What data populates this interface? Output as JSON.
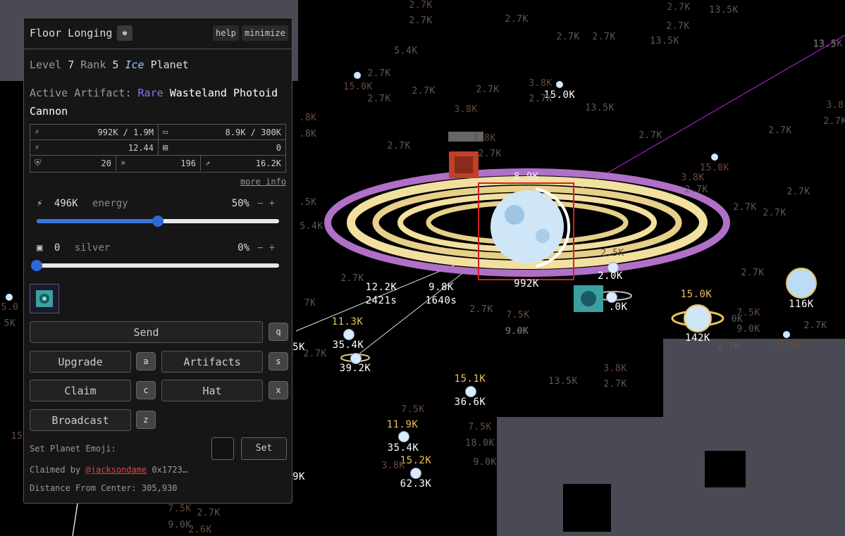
{
  "panel": {
    "title": "Floor Longing",
    "help_label": "help",
    "minimize_label": "minimize",
    "level_label": "Level",
    "level_value": "7",
    "rank_label": "Rank",
    "rank_value": "5",
    "planet_type_tag": "Ice",
    "planet_word": "Planet",
    "artifact_label": "Active Artifact:",
    "artifact_rarity": "Rare",
    "artifact_name_line1": "Wasteland Photoid",
    "artifact_name_line2": "Cannon",
    "stats": {
      "energy": "992K / 1.9M",
      "silver": "8.9K / 300K",
      "energy_growth": "12.44",
      "silver_growth": "0",
      "defense": "20",
      "speed": "196",
      "range": "16.2K"
    },
    "more_info": "more info",
    "energy_slider": {
      "amount": "496K",
      "label": "energy",
      "percent": "50%",
      "fraction": 0.5,
      "minus": "−",
      "plus": "+"
    },
    "silver_slider": {
      "amount": "0",
      "label": "silver",
      "percent": "0%",
      "fraction": 0.0,
      "minus": "−",
      "plus": "+"
    },
    "buttons": {
      "send": "Send",
      "send_key": "q",
      "upgrade": "Upgrade",
      "upgrade_key": "a",
      "artifacts": "Artifacts",
      "artifacts_key": "s",
      "claim": "Claim",
      "claim_key": "c",
      "hat": "Hat",
      "hat_key": "x",
      "broadcast": "Broadcast",
      "broadcast_key": "z"
    },
    "emoji_label": "Set Planet Emoji:",
    "set_label": "Set",
    "claimed_by_label": "Claimed by",
    "claimed_by_user": "@jacksondame",
    "claimed_by_address": "0x1723…",
    "distance_label": "Distance From Center:",
    "distance_value": "305,930"
  },
  "map": {
    "selected_planet": {
      "energy_label": "8.9K",
      "bottom_label": "992K"
    },
    "fleet_a": {
      "amount": "12.2K",
      "eta": "2421s"
    },
    "fleet_b": {
      "amount": "9.8K",
      "eta": "1640s"
    },
    "labels": [
      {
        "text": "2.7K",
        "c": "brown"
      },
      {
        "text": "2.7K",
        "c": "grey"
      },
      {
        "text": "2.7K",
        "c": "grey"
      },
      {
        "text": "2.7K",
        "c": "grey"
      },
      {
        "text": "2.7K",
        "c": "grey"
      },
      {
        "text": "2.7K",
        "c": "brown"
      },
      {
        "text": "13.5K",
        "c": "grey"
      },
      {
        "text": "2.7K",
        "c": "grey"
      },
      {
        "text": "13.5K",
        "c": "grey"
      },
      {
        "text": "13.5K",
        "c": "grey"
      },
      {
        "text": "5.4K",
        "c": "grey"
      },
      {
        "text": "2.7K",
        "c": "grey"
      },
      {
        "text": "15.0K",
        "c": "brown"
      },
      {
        "text": "2.7K",
        "c": "grey"
      },
      {
        "text": "2.7K",
        "c": "grey"
      },
      {
        "text": "2.7K",
        "c": "grey"
      },
      {
        "text": "3.8K",
        "c": "brown"
      },
      {
        "text": "15.0K",
        "c": "white"
      },
      {
        "text": "2.7K",
        "c": "grey"
      },
      {
        "text": "13.5K",
        "c": "grey"
      },
      {
        "text": "3.8K",
        "c": "brown"
      },
      {
        "text": "3.8K",
        "c": "brown"
      },
      {
        "text": "2.7K",
        "c": "grey"
      },
      {
        "text": "2.7K",
        "c": "grey"
      },
      {
        "text": "2.7K",
        "c": "grey"
      },
      {
        "text": "2.7K",
        "c": "grey"
      },
      {
        "text": "15.0K",
        "c": "brown"
      },
      {
        "text": "3.8K",
        "c": "brown"
      },
      {
        "text": "2.7K",
        "c": "grey"
      },
      {
        "text": "2.7K",
        "c": "grey"
      },
      {
        "text": "2.7K",
        "c": "grey"
      },
      {
        "text": "2.7K",
        "c": "grey"
      },
      {
        "text": "2.7K",
        "c": "grey"
      },
      {
        "text": "15.0K",
        "c": "yellow"
      },
      {
        "text": "116K",
        "c": "white"
      },
      {
        "text": "142K",
        "c": "white"
      },
      {
        "text": "7.5K",
        "c": "brown"
      },
      {
        "text": "9.0K",
        "c": "grey"
      },
      {
        "text": "2.7K",
        "c": "grey"
      },
      {
        "text": "2.7K",
        "c": "grey"
      },
      {
        "text": "15.0K",
        "c": "brown"
      },
      {
        "text": "11.3K",
        "c": "yellow"
      },
      {
        "text": "35.4K",
        "c": "white"
      },
      {
        "text": "39.2K",
        "c": "white"
      },
      {
        "text": "7.5K",
        "c": "brown"
      },
      {
        "text": "9.0K",
        "c": "grey"
      },
      {
        "text": "2.7K",
        "c": "grey"
      },
      {
        "text": "3.8K",
        "c": "brown"
      },
      {
        "text": "2.7K",
        "c": "grey"
      },
      {
        "text": "13.5K",
        "c": "grey"
      },
      {
        "text": "15.1K",
        "c": "yellow"
      },
      {
        "text": "36.6K",
        "c": "white"
      },
      {
        "text": "7.5K",
        "c": "brown"
      },
      {
        "text": "11.9K",
        "c": "yellow"
      },
      {
        "text": "35.4K",
        "c": "white"
      },
      {
        "text": "7.5K",
        "c": "brown"
      },
      {
        "text": "18.0K",
        "c": "grey"
      },
      {
        "text": "15.2K",
        "c": "yellow"
      },
      {
        "text": "62.3K",
        "c": "white"
      },
      {
        "text": "9.0K",
        "c": "grey"
      },
      {
        "text": "3.8K",
        "c": "brown"
      },
      {
        "text": "7.5K",
        "c": "brown"
      },
      {
        "text": "2.7K",
        "c": "grey"
      },
      {
        "text": "9.0K",
        "c": "grey"
      },
      {
        "text": "2.6K",
        "c": "brown"
      },
      {
        "text": "2.5K",
        "c": "brown"
      },
      {
        "text": "2.0K",
        "c": "white"
      },
      {
        "text": ".0K",
        "c": "white"
      },
      {
        "text": "5.0",
        "c": "brown"
      },
      {
        "text": "5K",
        "c": "grey"
      },
      {
        "text": "15",
        "c": "brown"
      },
      {
        "text": "5K",
        "c": "white"
      },
      {
        "text": "9K",
        "c": "white"
      },
      {
        "text": "7K",
        "c": "grey"
      },
      {
        "text": "2.7K",
        "c": "grey"
      },
      {
        "text": ".8K",
        "c": "brown"
      },
      {
        "text": ".8K",
        "c": "grey"
      },
      {
        "text": ".5K",
        "c": "grey"
      },
      {
        "text": "5.4K",
        "c": "grey"
      },
      {
        "text": "0K",
        "c": "grey"
      },
      {
        "text": "9.0K",
        "c": "grey"
      },
      {
        "text": "2.7K",
        "c": "grey"
      },
      {
        "text": "3.8",
        "c": "brown"
      },
      {
        "text": "2.7K",
        "c": "grey"
      },
      {
        "text": "13.5",
        "c": "grey"
      }
    ]
  }
}
